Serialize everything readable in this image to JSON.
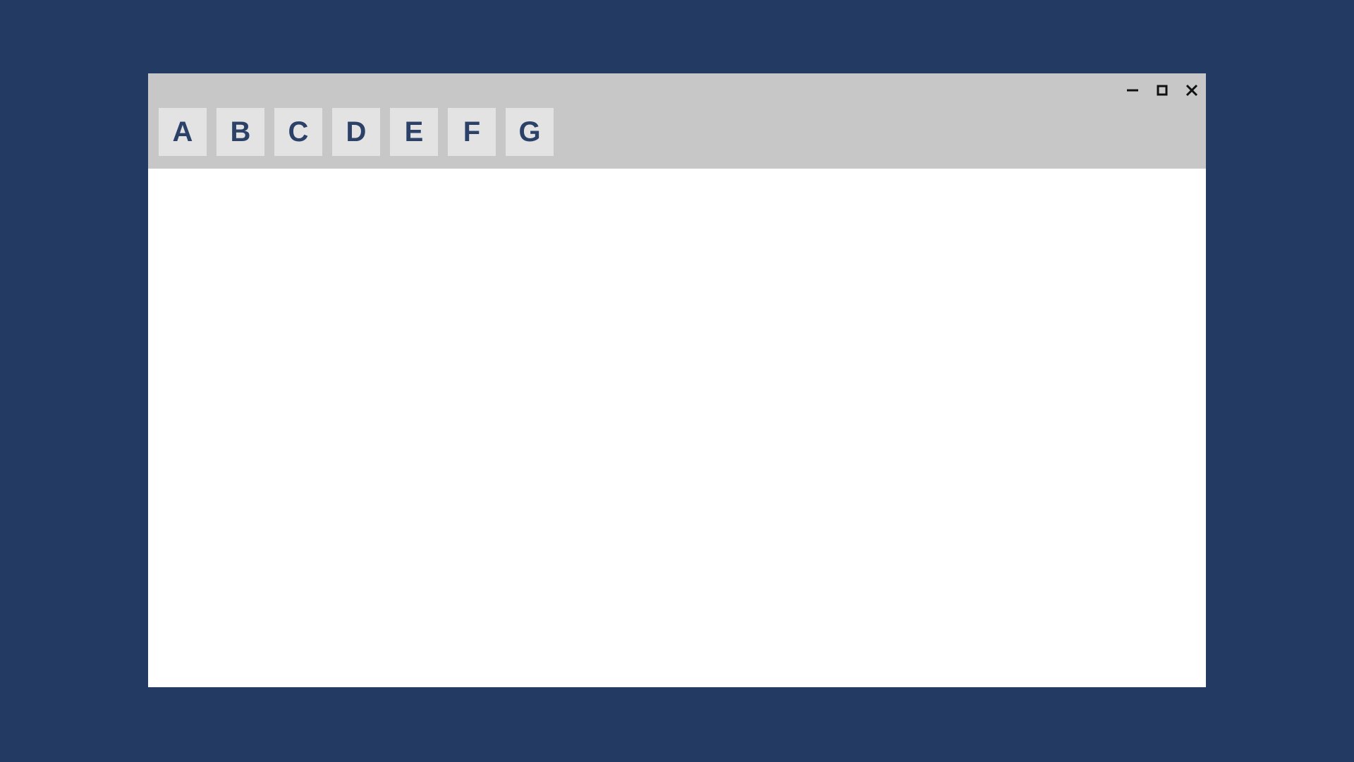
{
  "window": {
    "controls": {
      "minimize": "minimize",
      "maximize": "maximize",
      "close": "close"
    }
  },
  "tabs": [
    {
      "label": "A"
    },
    {
      "label": "B"
    },
    {
      "label": "C"
    },
    {
      "label": "D"
    },
    {
      "label": "E"
    },
    {
      "label": "F"
    },
    {
      "label": "G"
    }
  ]
}
